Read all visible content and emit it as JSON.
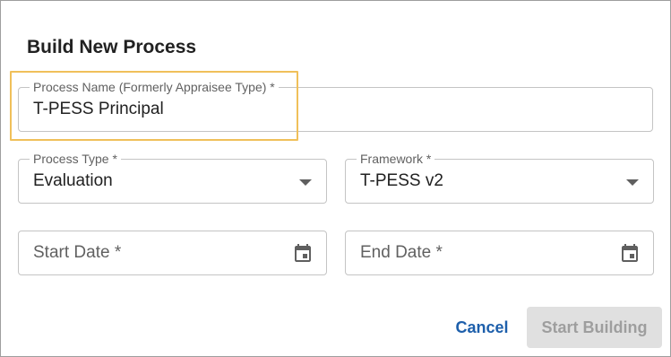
{
  "dialog": {
    "title": "Build New Process"
  },
  "form": {
    "process_name": {
      "label": "Process Name (Formerly Appraisee Type) *",
      "value": "T-PESS Principal"
    },
    "process_type": {
      "label": "Process Type *",
      "value": "Evaluation"
    },
    "framework": {
      "label": "Framework *",
      "value": "T-PESS v2"
    },
    "start_date": {
      "placeholder": "Start Date *"
    },
    "end_date": {
      "placeholder": "End Date *"
    }
  },
  "actions": {
    "cancel_label": "Cancel",
    "start_label": "Start Building"
  },
  "colors": {
    "highlight": "#f0c05a",
    "link": "#1d5fab",
    "disabled_bg": "#e0e0e0",
    "disabled_text": "#9e9e9e"
  },
  "icons": [
    "chevron-down-icon",
    "calendar-icon"
  ]
}
